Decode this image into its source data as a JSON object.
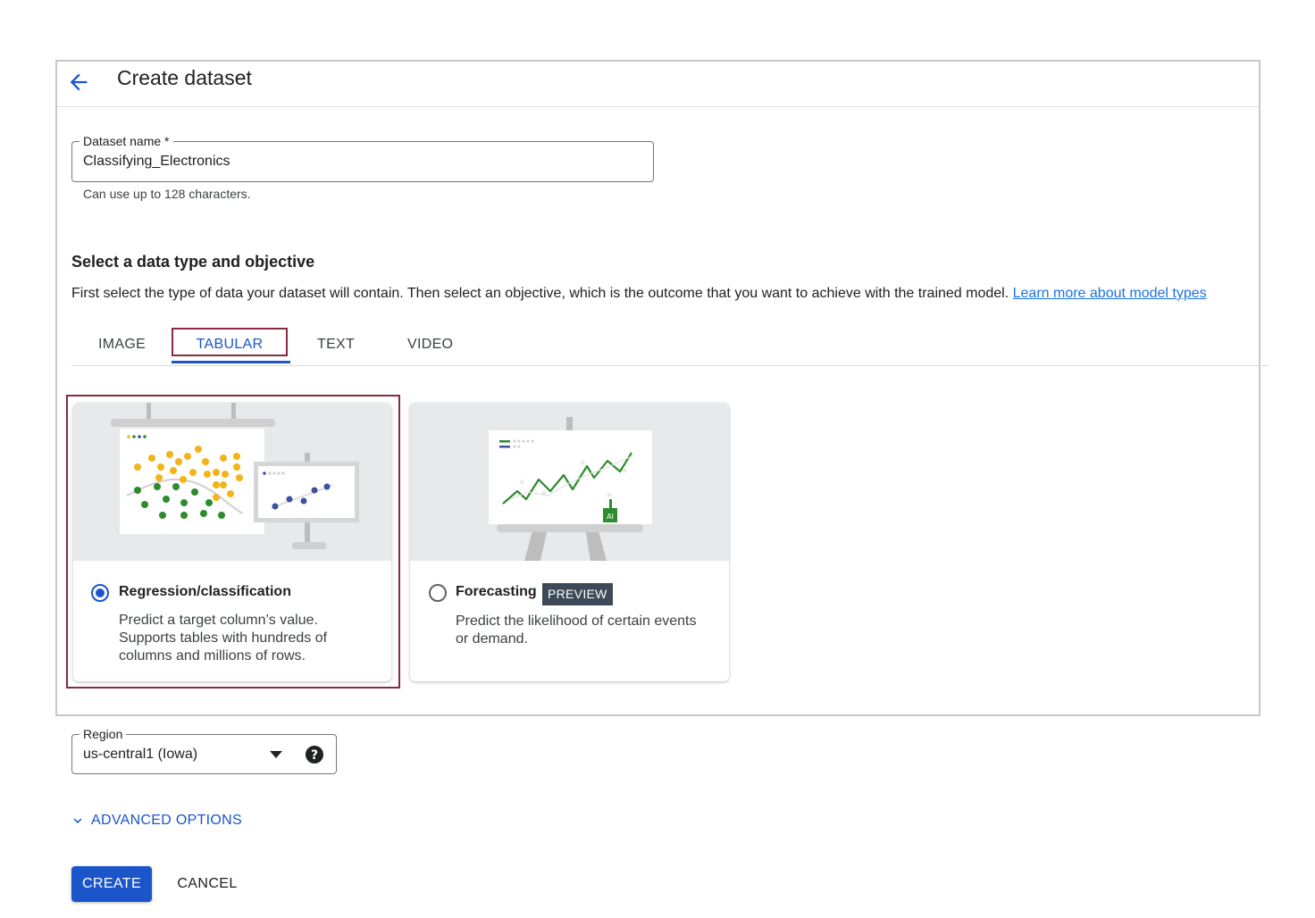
{
  "header": {
    "title": "Create dataset",
    "back_icon": "arrow-left-icon"
  },
  "dataset_name": {
    "label": "Dataset name *",
    "value": "Classifying_Electronics",
    "hint": "Can use up to 128 characters."
  },
  "objective": {
    "title": "Select a data type and objective",
    "description": "First select the type of data your dataset will contain. Then select an objective, which is the outcome that you want to achieve with the trained model.",
    "learn_more": "Learn more about model types"
  },
  "tabs": [
    {
      "label": "IMAGE",
      "active": false
    },
    {
      "label": "TABULAR",
      "active": true
    },
    {
      "label": "TEXT",
      "active": false
    },
    {
      "label": "VIDEO",
      "active": false
    }
  ],
  "cards": [
    {
      "title": "Regression/classification",
      "desc_lines": [
        "Predict a target column’s value.",
        "Supports tables with hundreds of",
        "columns and millions of rows."
      ],
      "selected": true
    },
    {
      "title": "Forecasting",
      "badge": "PREVIEW",
      "desc_lines": [
        "Predict the likelihood of certain events",
        "or demand."
      ],
      "selected": false,
      "illus_badge": "AI"
    }
  ],
  "region": {
    "label": "Region",
    "value": "us-central1 (Iowa)",
    "help_icon": "help-circle-icon",
    "dropdown_icon": "arrow-drop-down-icon"
  },
  "advanced_options": {
    "label": "ADVANCED OPTIONS",
    "icon": "chevron-down-icon"
  },
  "actions": {
    "create": "CREATE",
    "cancel": "CANCEL"
  },
  "colors": {
    "accent": "#1a56c9",
    "highlight_border": "#8a2a3c",
    "badge_bg": "#3c4a57",
    "dot_yellow": "#f2b418",
    "dot_green": "#2e8b2e",
    "dot_blue": "#3c4fa0"
  }
}
